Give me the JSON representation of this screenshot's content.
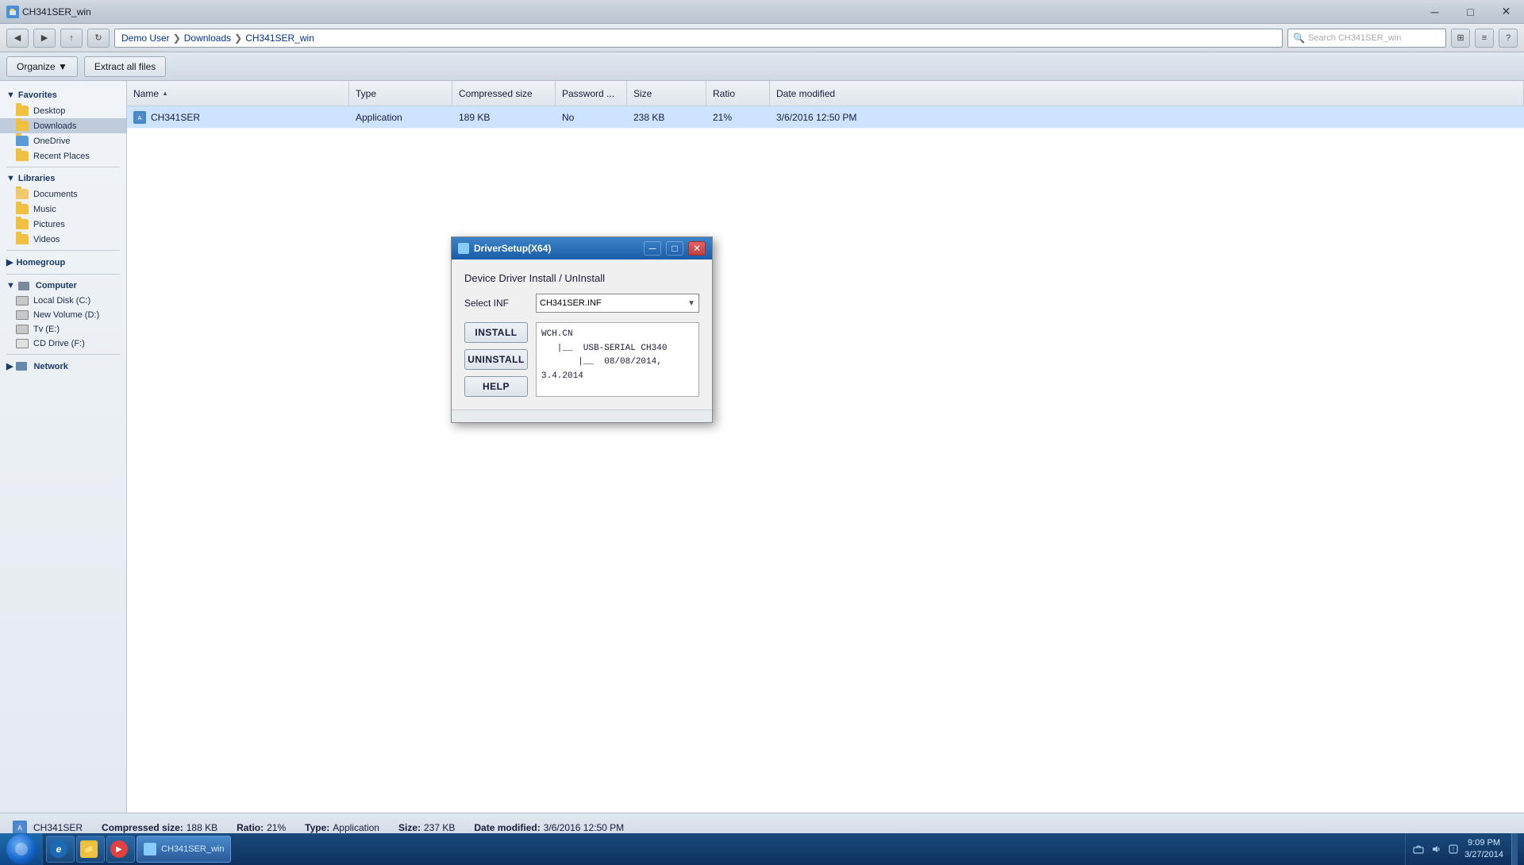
{
  "window": {
    "title": "CH341SER_win",
    "titlebar_text": "CH341SER_win"
  },
  "addressbar": {
    "breadcrumb": [
      "Demo User",
      "Downloads",
      "CH341SER_win"
    ],
    "search_placeholder": "Search CH341SER_win"
  },
  "toolbar": {
    "organize_label": "Organize ▼",
    "extract_label": "Extract all files"
  },
  "columns": {
    "name": "Name",
    "type": "Type",
    "compressed_size": "Compressed size",
    "password": "Password ...",
    "size": "Size",
    "ratio": "Ratio",
    "date_modified": "Date modified"
  },
  "files": [
    {
      "name": "CH341SER",
      "type": "Application",
      "compressed_size": "189 KB",
      "password": "No",
      "size": "238 KB",
      "ratio": "21%",
      "date_modified": "3/6/2016 12:50 PM"
    }
  ],
  "sidebar": {
    "favorites_label": "Favorites",
    "favorites_items": [
      {
        "label": "Desktop",
        "icon": "folder"
      },
      {
        "label": "Downloads",
        "icon": "folder"
      },
      {
        "label": "OneDrive",
        "icon": "folder"
      },
      {
        "label": "Recent Places",
        "icon": "folder"
      }
    ],
    "libraries_label": "Libraries",
    "libraries_items": [
      {
        "label": "Documents",
        "icon": "folder"
      },
      {
        "label": "Music",
        "icon": "folder"
      },
      {
        "label": "Pictures",
        "icon": "folder"
      },
      {
        "label": "Videos",
        "icon": "folder"
      }
    ],
    "homegroup_label": "Homegroup",
    "computer_label": "Computer",
    "computer_items": [
      {
        "label": "Local Disk (C:)",
        "icon": "drive"
      },
      {
        "label": "New Volume (D:)",
        "icon": "drive"
      },
      {
        "label": "Tv (E:)",
        "icon": "drive"
      },
      {
        "label": "CD Drive (F:)",
        "icon": "drive"
      }
    ],
    "network_label": "Network"
  },
  "status_bar": {
    "filename": "CH341SER",
    "compressed_label": "Compressed size:",
    "compressed_value": "188 KB",
    "ratio_label": "Ratio:",
    "ratio_value": "21%",
    "type_label": "Type:",
    "type_value": "Application",
    "size_label": "Size:",
    "size_value": "237 KB",
    "date_label": "Date modified:",
    "date_value": "3/6/2016 12:50 PM"
  },
  "dialog": {
    "title": "DriverSetup(X64)",
    "heading": "Device Driver Install / UnInstall",
    "select_label": "Select INF",
    "select_value": "CH341SER.INF",
    "info_text": "WCH.CN\n   |__  USB-SERIAL CH340\n       |__  08/08/2014, 3.4.2014",
    "install_label": "INSTALL",
    "uninstall_label": "UNINSTALL",
    "help_label": "HELP"
  },
  "taskbar": {
    "time": "9:09 PM",
    "date": "3/27/2014",
    "apps": [
      {
        "label": "CH341SER_win",
        "active": true
      }
    ]
  },
  "icons": {
    "minimize": "─",
    "maximize": "□",
    "close": "✕",
    "search": "🔍",
    "back": "◀",
    "forward": "▶",
    "up": "↑",
    "dropdown": "▼",
    "chevron_right": "❯"
  }
}
